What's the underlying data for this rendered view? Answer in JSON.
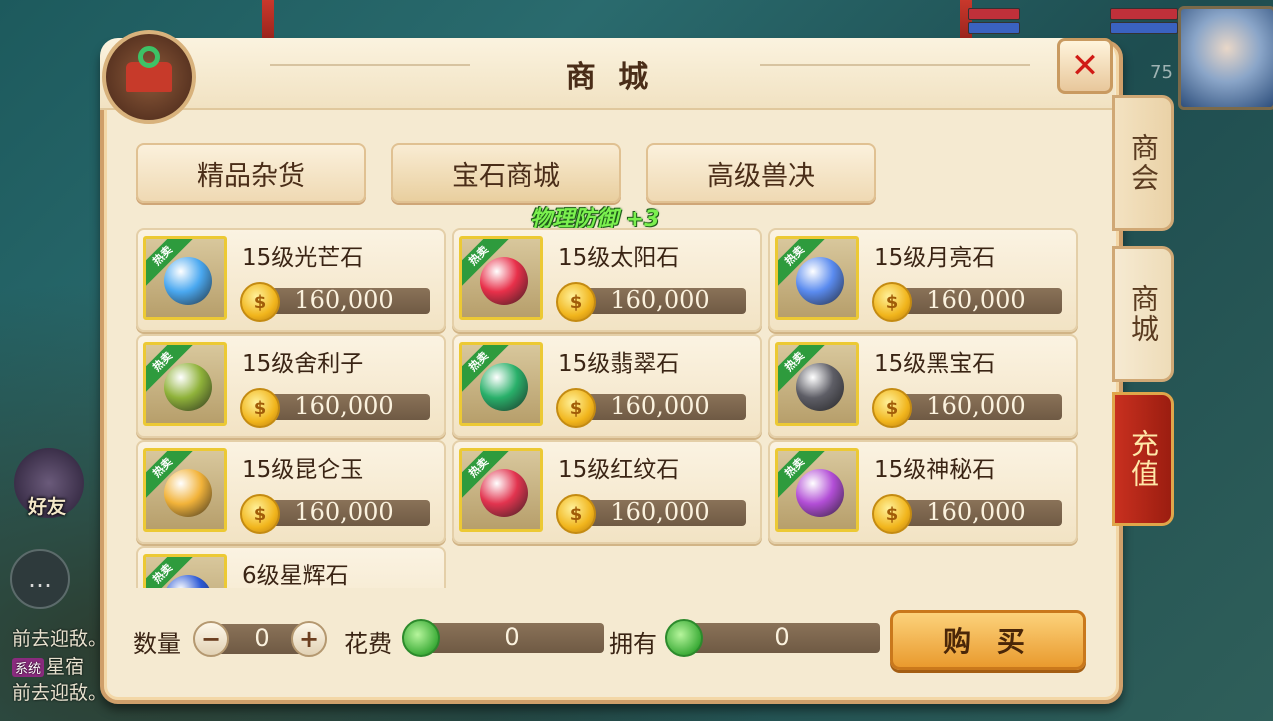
{
  "panel": {
    "title": "商 城"
  },
  "tabs": [
    "精品杂货",
    "宝石商城",
    "高级兽决"
  ],
  "side_tabs": [
    "商会",
    "商城",
    "充值"
  ],
  "bonus_text": "物理防御 +3",
  "hot_badge": "热卖",
  "items": [
    {
      "name": "15级光芒石",
      "price": "160,000",
      "gem_color": "#4aa8f0",
      "icon": "blue-crystal-icon"
    },
    {
      "name": "15级太阳石",
      "price": "160,000",
      "gem_color": "#e8304a",
      "icon": "red-sun-stone-icon"
    },
    {
      "name": "15级月亮石",
      "price": "160,000",
      "gem_color": "#5a8bef",
      "icon": "blue-moon-stone-icon"
    },
    {
      "name": "15级舍利子",
      "price": "160,000",
      "gem_color": "#8fb23a",
      "icon": "green-relic-icon"
    },
    {
      "name": "15级翡翠石",
      "price": "160,000",
      "gem_color": "#29b06a",
      "icon": "jade-orb-icon"
    },
    {
      "name": "15级黑宝石",
      "price": "160,000",
      "gem_color": "#5e5e66",
      "icon": "black-gem-icon"
    },
    {
      "name": "15级昆仑玉",
      "price": "160,000",
      "gem_color": "#f2b33a",
      "icon": "kunlun-jade-icon"
    },
    {
      "name": "15级红纹石",
      "price": "160,000",
      "gem_color": "#e2344f",
      "icon": "red-pattern-stone-icon"
    },
    {
      "name": "15级神秘石",
      "price": "160,000",
      "gem_color": "#b24ed6",
      "icon": "mystery-crystal-icon"
    },
    {
      "name": "6级星辉石",
      "price": "",
      "gem_color": "#2b59d6",
      "icon": "star-stone-icon"
    }
  ],
  "bottom": {
    "qty_label": "数量",
    "qty_value": "0",
    "cost_label": "花费",
    "cost_value": "0",
    "own_label": "拥有",
    "own_value": "0",
    "buy_label": "购 买"
  },
  "hud": {
    "level": "75",
    "friend_label": "好友"
  },
  "chat": {
    "line1": "前去迎敌。",
    "tag": "系统",
    "line2_suffix": "星宿",
    "line3": "前去迎敌。"
  },
  "colors": {
    "accent": "#e99a2e",
    "panel_bg": "#f5ead1",
    "close": "#d01b16"
  }
}
